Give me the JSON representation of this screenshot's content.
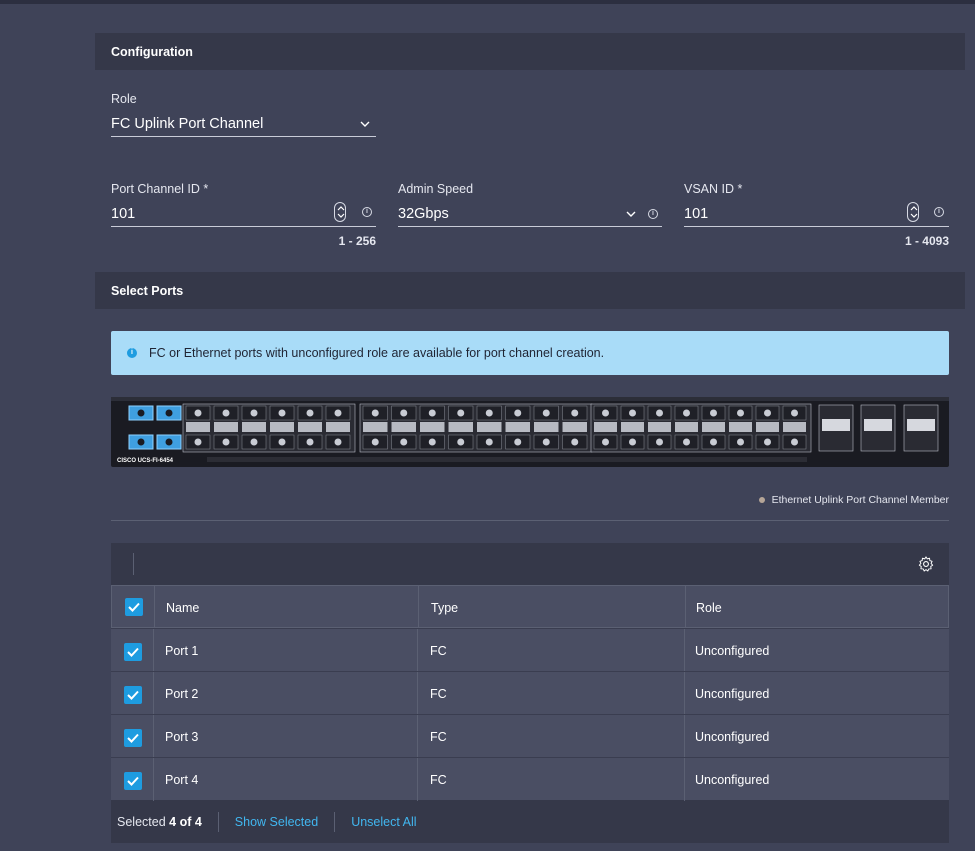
{
  "configuration": {
    "header": "Configuration",
    "role": {
      "label": "Role",
      "value": "FC Uplink Port Channel"
    },
    "port_channel_id": {
      "label": "Port Channel ID *",
      "value": "101",
      "range": "1 - 256"
    },
    "admin_speed": {
      "label": "Admin Speed",
      "value": "32Gbps"
    },
    "vsan_id": {
      "label": "VSAN ID *",
      "value": "101",
      "range": "1 - 4093"
    }
  },
  "select_ports": {
    "header": "Select Ports",
    "banner": "FC or Ethernet ports with unconfigured role are available for port channel creation.",
    "switch_model": "CISCO UCS-FI-6454",
    "legend": "Ethernet Uplink Port Channel Member",
    "table": {
      "columns": [
        "Name",
        "Type",
        "Role"
      ],
      "rows": [
        {
          "name": "Port 1",
          "type": "FC",
          "role": "Unconfigured",
          "checked": true
        },
        {
          "name": "Port 2",
          "type": "FC",
          "role": "Unconfigured",
          "checked": true
        },
        {
          "name": "Port 3",
          "type": "FC",
          "role": "Unconfigured",
          "checked": true
        },
        {
          "name": "Port 4",
          "type": "FC",
          "role": "Unconfigured",
          "checked": true
        }
      ],
      "selected_prefix": "Selected",
      "selected_count": "4 of 4",
      "show_selected": "Show Selected",
      "unselect_all": "Unselect All"
    }
  },
  "colors": {
    "accent": "#1e9ce0",
    "link": "#41b6ef",
    "banner": "#a9dcf8",
    "background": "#3f4358"
  }
}
